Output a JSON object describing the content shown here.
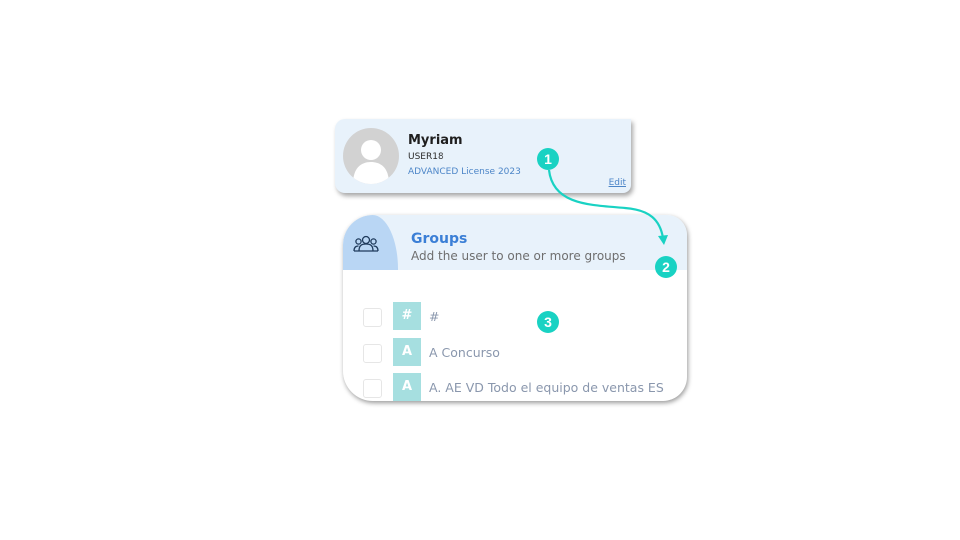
{
  "user_card": {
    "name": "Myriam",
    "user_id": "USER18",
    "license": "ADVANCED License 2023",
    "edit_label": "Edit"
  },
  "groups_panel": {
    "title": "Groups",
    "subtitle": "Add the user to one or more groups",
    "items": [
      {
        "initial": "#",
        "name": "#",
        "checked": false
      },
      {
        "initial": "A",
        "name": "A Concurso",
        "checked": false
      },
      {
        "initial": "A",
        "name": "A. AE VD Todo el equipo de ventas ES",
        "checked": false
      }
    ]
  },
  "annotations": {
    "step1": "1",
    "step2": "2",
    "step3": "3"
  },
  "colors": {
    "accent_teal": "#19d2c3",
    "header_bg": "#e8f2fb",
    "icon_box_bg": "#b9d6f4",
    "title_blue": "#3b7fd6",
    "initial_bg": "#a6dfe0"
  },
  "icons": {
    "avatar": "user-silhouette-icon",
    "groups": "users-group-icon"
  }
}
